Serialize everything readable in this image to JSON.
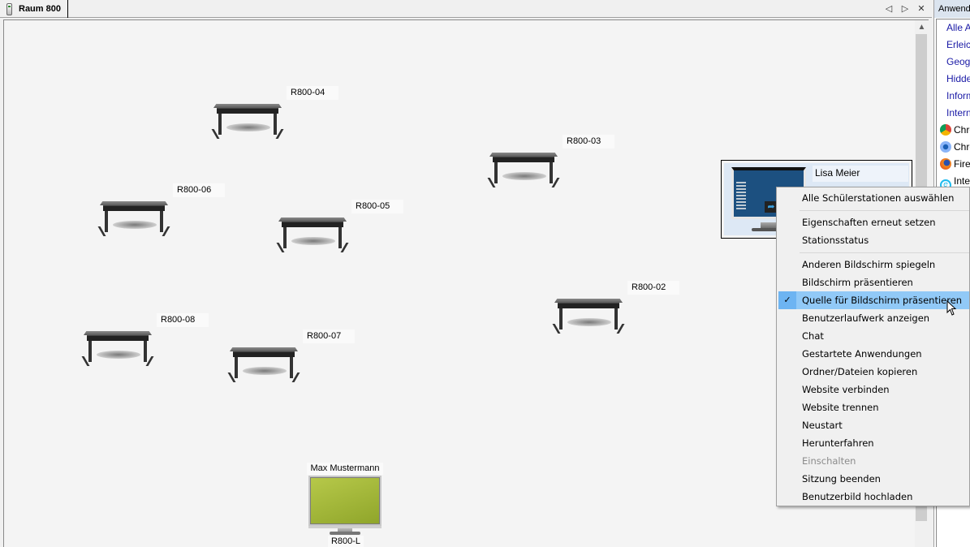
{
  "tab": {
    "label": "Raum 800",
    "icon": "station-icon"
  },
  "tab_controls": {
    "prev": "◁",
    "next": "▷",
    "close": "✕"
  },
  "room": {
    "desks": [
      {
        "id": "R800-04"
      },
      {
        "id": "R800-03"
      },
      {
        "id": "R800-06"
      },
      {
        "id": "R800-05"
      },
      {
        "id": "R800-02"
      },
      {
        "id": "R800-08"
      },
      {
        "id": "R800-07"
      }
    ],
    "teacher": {
      "name": "Max Mustermann",
      "station": "R800-L"
    },
    "student": {
      "name": "Lisa Meier"
    }
  },
  "right_pane": {
    "header": "Anwendungen",
    "items": [
      {
        "label": "Alle Anwendungen",
        "type": "category"
      },
      {
        "label": "Erleichterte Bedienung",
        "type": "category"
      },
      {
        "label": "Geographie",
        "type": "category"
      },
      {
        "label": "Hidden",
        "type": "category"
      },
      {
        "label": "Informatik",
        "type": "category"
      },
      {
        "label": "Internet",
        "type": "category"
      },
      {
        "label": "Chrome",
        "type": "program",
        "icon": "chrome-icon",
        "color": "#db4437"
      },
      {
        "label": "Chromium",
        "type": "program",
        "icon": "chromium-icon",
        "color": "#4a8af4"
      },
      {
        "label": "Firefox",
        "type": "program",
        "icon": "firefox-icon",
        "color": "#e66000"
      },
      {
        "label": "Internet Explorer",
        "type": "program",
        "icon": "internet-explorer-icon",
        "color": "#1ebbee"
      }
    ]
  },
  "context_menu": {
    "items": [
      {
        "label": "Alle Schülerstationen auswählen"
      },
      {
        "separator": true
      },
      {
        "label": "Eigenschaften erneut setzen"
      },
      {
        "label": "Stationsstatus"
      },
      {
        "separator": true
      },
      {
        "label": "Anderen Bildschirm spiegeln"
      },
      {
        "label": "Bildschirm präsentieren"
      },
      {
        "label": "Quelle für Bildschirm präsentieren",
        "checked": true,
        "highlighted": true
      },
      {
        "label": "Benutzerlaufwerk anzeigen"
      },
      {
        "label": "Chat"
      },
      {
        "label": "Gestartete Anwendungen"
      },
      {
        "label": "Ordner/Dateien kopieren"
      },
      {
        "label": "Website verbinden"
      },
      {
        "label": "Website trennen"
      },
      {
        "label": "Neustart"
      },
      {
        "label": "Herunterfahren"
      },
      {
        "label": "Einschalten",
        "disabled": true
      },
      {
        "label": "Sitzung beenden"
      },
      {
        "label": "Benutzerbild hochladen"
      }
    ],
    "check_glyph": "✓"
  },
  "colors": {
    "highlight": "#91c9f7",
    "check_bg": "#6db4f2",
    "link": "#1a1aa6",
    "teacher_screen": "#a3b83a"
  }
}
